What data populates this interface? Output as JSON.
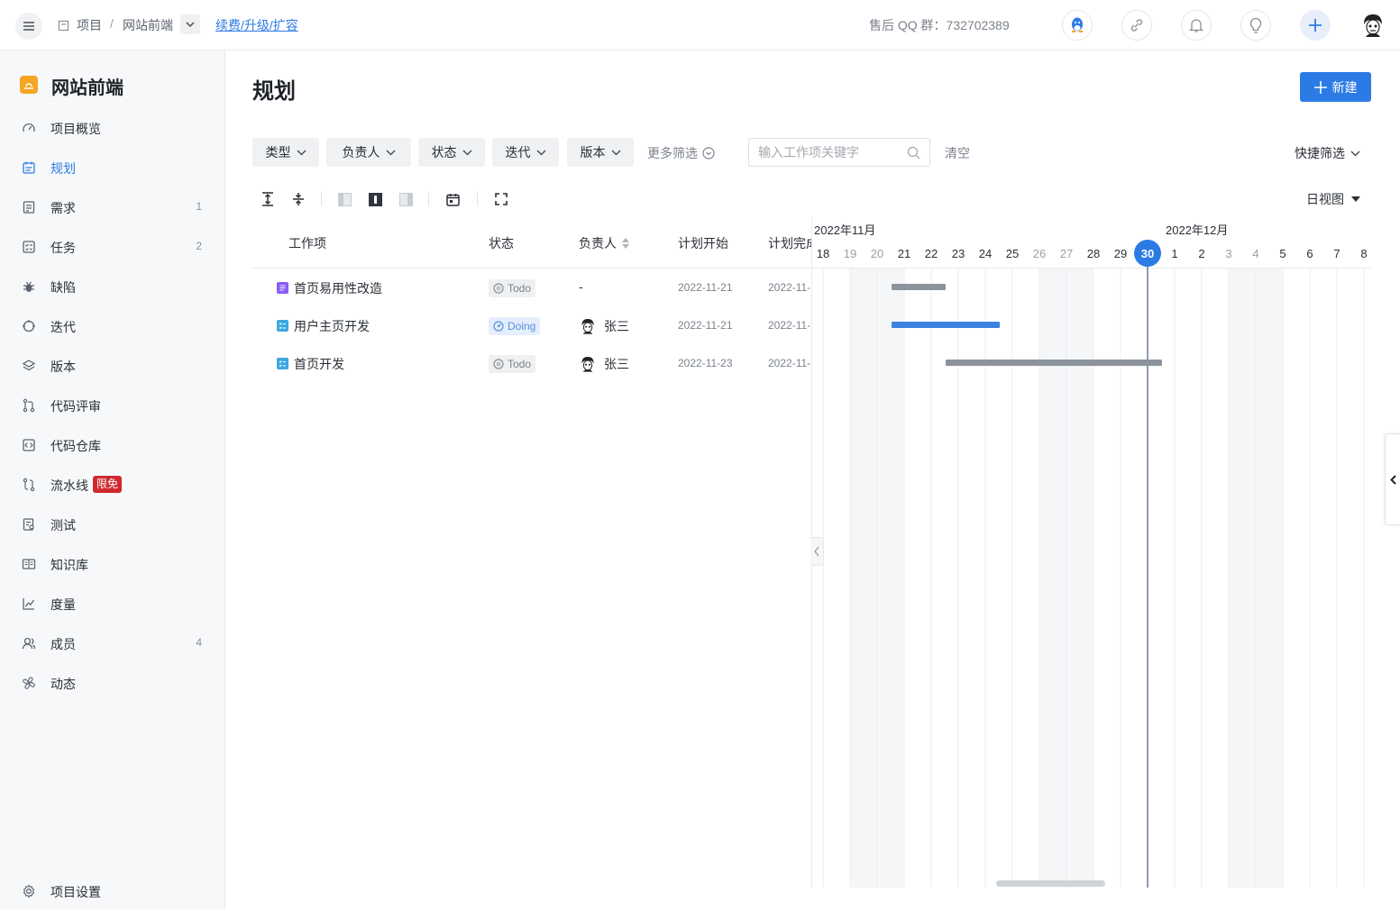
{
  "topbar": {
    "breadcrumb_root": "项目",
    "breadcrumb_sep": "/",
    "breadcrumb_project": "网站前端",
    "renew_link": "续费/升级/扩容",
    "qq_group": "售后 QQ 群：732702389"
  },
  "sidebar": {
    "project_name": "网站前端",
    "items": [
      {
        "label": "项目概览",
        "count": "",
        "icon": "dashboard-icon"
      },
      {
        "label": "规划",
        "count": "",
        "icon": "calendar-icon",
        "active": true
      },
      {
        "label": "需求",
        "count": "1",
        "icon": "document-icon"
      },
      {
        "label": "任务",
        "count": "2",
        "icon": "task-list-icon"
      },
      {
        "label": "缺陷",
        "count": "",
        "icon": "bug-icon"
      },
      {
        "label": "迭代",
        "count": "",
        "icon": "cycle-icon"
      },
      {
        "label": "版本",
        "count": "",
        "icon": "layers-icon"
      },
      {
        "label": "代码评审",
        "count": "",
        "icon": "pull-request-icon"
      },
      {
        "label": "代码仓库",
        "count": "",
        "icon": "code-icon"
      },
      {
        "label": "流水线",
        "count": "",
        "icon": "pipeline-icon",
        "badge": "限免"
      },
      {
        "label": "测试",
        "count": "",
        "icon": "test-icon"
      },
      {
        "label": "知识库",
        "count": "",
        "icon": "book-icon"
      },
      {
        "label": "度量",
        "count": "",
        "icon": "chart-icon"
      },
      {
        "label": "成员",
        "count": "4",
        "icon": "members-icon"
      },
      {
        "label": "动态",
        "count": "",
        "icon": "activity-icon"
      }
    ],
    "settings_label": "项目设置"
  },
  "main": {
    "title": "规划",
    "new_button": "新建",
    "filters": [
      "类型",
      "负责人",
      "状态",
      "迭代",
      "版本"
    ],
    "more_filters": "更多筛选",
    "search_placeholder": "输入工作项关键字",
    "clear": "清空",
    "quick_filter": "快捷筛选",
    "view_mode": "日视图"
  },
  "table": {
    "columns": [
      "工作项",
      "状态",
      "负责人",
      "计划开始",
      "计划完成"
    ],
    "rows": [
      {
        "type": "requirement",
        "type_color": "#8b5cf6",
        "title": "首页易用性改造",
        "status": "Todo",
        "owner": "-",
        "start": "2022-11-21",
        "end": "2022-11-"
      },
      {
        "type": "task",
        "type_color": "#3ba8e0",
        "title": "用户主页开发",
        "status": "Doing",
        "owner": "张三",
        "start": "2022-11-21",
        "end": "2022-11-"
      },
      {
        "type": "task",
        "type_color": "#3ba8e0",
        "title": "首页开发",
        "status": "Todo",
        "owner": "张三",
        "start": "2022-11-23",
        "end": "2022-11-"
      }
    ]
  },
  "gantt": {
    "months": [
      {
        "label": "2022年11月",
        "first_day": "18"
      },
      {
        "label": "2022年12月",
        "first_day": "1"
      }
    ],
    "days": [
      "18",
      "19",
      "20",
      "21",
      "22",
      "23",
      "24",
      "25",
      "26",
      "27",
      "28",
      "29",
      "30",
      "1",
      "2",
      "3",
      "4",
      "5",
      "6",
      "7",
      "8"
    ],
    "weekend_days": [
      "19",
      "20",
      "26",
      "27",
      "3",
      "4"
    ],
    "today": "30",
    "bars": [
      {
        "row": 0,
        "start": "2022-11-21",
        "end": "2022-11-22",
        "color": "#8c939d"
      },
      {
        "row": 1,
        "start": "2022-11-21",
        "end": "2022-11-24",
        "color": "#3b82e0"
      },
      {
        "row": 2,
        "start": "2022-11-23",
        "end": "2022-11-30",
        "color": "#8c939d"
      }
    ]
  },
  "colors": {
    "accent": "#2c7be5",
    "badge": "#d0282e",
    "logo": "#f5a623"
  }
}
